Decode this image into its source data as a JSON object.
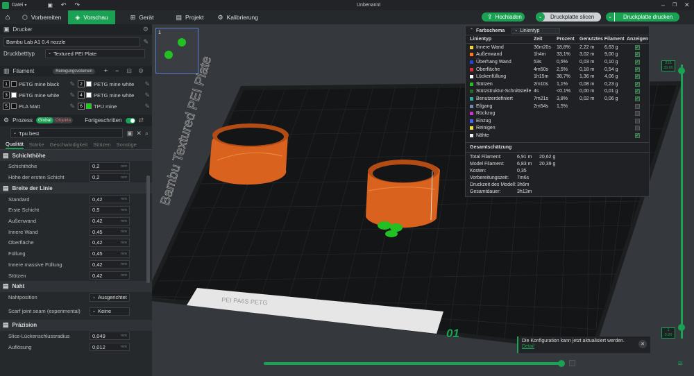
{
  "titlebar": {
    "menu_label": "Datei",
    "doc_title": "Unbenannt"
  },
  "tabs": [
    {
      "label": "Vorbereiten"
    },
    {
      "label": "Vorschau"
    },
    {
      "label": "Gerät"
    },
    {
      "label": "Projekt"
    },
    {
      "label": "Kalibrierung"
    }
  ],
  "actions": {
    "upload": "Hochladen",
    "slice": "Druckplatte slicen",
    "print": "Druckplatte drucken"
  },
  "printer": {
    "section": "Drucker",
    "name": "Bambu Lab A1 0.4 nozzle",
    "bed_label": "Druckbetttyp",
    "bed_value": "Textured PEI Plate"
  },
  "filament": {
    "section": "Filament",
    "purge_label": "Reinigungsvolumen",
    "slots": [
      {
        "num": "1",
        "name": "PETG mine black",
        "color": "#111111"
      },
      {
        "num": "2",
        "name": "PETG mine white",
        "color": "#ffffff"
      },
      {
        "num": "3",
        "name": "PETG mine white",
        "color": "#ffffff"
      },
      {
        "num": "4",
        "name": "PETG mine white",
        "color": "#ffffff"
      },
      {
        "num": "5",
        "name": "PLA Matt",
        "color": "#111111"
      },
      {
        "num": "6",
        "name": "TPU mine",
        "color": "#00e000"
      }
    ]
  },
  "process": {
    "section": "Prozess",
    "global": "Global",
    "objects": "Objekte",
    "advanced": "Fortgeschritten",
    "preset": "Tpu best",
    "subtabs": [
      "Qualität",
      "Stärke",
      "Geschwindigkeit",
      "Stützen",
      "Sonstige"
    ],
    "unit": "mm"
  },
  "params": {
    "layer_height": {
      "title": "Schichthöhe",
      "rows": [
        {
          "label": "Schichthöhe",
          "value": "0,2"
        },
        {
          "label": "Höhe der ersten Schicht",
          "value": "0,2"
        }
      ]
    },
    "line_width": {
      "title": "Breite der Linie",
      "rows": [
        {
          "label": "Standard",
          "value": "0,42"
        },
        {
          "label": "Erste Schicht",
          "value": "0,5"
        },
        {
          "label": "Außenwand",
          "value": "0,42"
        },
        {
          "label": "Innere Wand",
          "value": "0,45"
        },
        {
          "label": "Oberfläche",
          "value": "0,42"
        },
        {
          "label": "Füllung",
          "value": "0,45"
        },
        {
          "label": "Innere massive Füllung",
          "value": "0,42"
        },
        {
          "label": "Stützen",
          "value": "0,42"
        }
      ]
    },
    "seam": {
      "title": "Naht",
      "pos_label": "Nahtposition",
      "pos_value": "Ausgerichtet",
      "scarf_label": "Scarf joint seam (experimental)",
      "scarf_value": "Keine"
    },
    "precision": {
      "title": "Präzision",
      "rows": [
        {
          "label": "Slice-Lückenschlussradius",
          "value": "0,049"
        },
        {
          "label": "Auflösung",
          "value": "0,012"
        }
      ]
    }
  },
  "plate": {
    "label": "Bambu Textured PEI Plate",
    "plate_num": "01",
    "thumb_num": "1",
    "bottom_text": "PEI PA6S PETG"
  },
  "stats": {
    "scheme_label": "Farbschema",
    "scheme_value": "Linientyp",
    "headers": [
      "Linientyp",
      "Zeit",
      "Prozent",
      "Genutztes Filament",
      "Anzeigen"
    ],
    "lines": [
      {
        "name": "Innere Wand",
        "color": "#f5d742",
        "time": "36m20s",
        "pct": "18,8%",
        "len": "2,22 m",
        "g": "6,63 g",
        "show": true
      },
      {
        "name": "Außenwand",
        "color": "#ff7a1a",
        "time": "1h4m",
        "pct": "33,1%",
        "len": "3,02 m",
        "g": "9,00 g",
        "show": true
      },
      {
        "name": "Überhang Wand",
        "color": "#2244dd",
        "time": "53s",
        "pct": "0,5%",
        "len": "0,03 m",
        "g": "0,10 g",
        "show": true
      },
      {
        "name": "Oberfläche",
        "color": "#e03030",
        "time": "4m50s",
        "pct": "2,5%",
        "len": "0,18 m",
        "g": "0,54 g",
        "show": true
      },
      {
        "name": "Lückenfüllung",
        "color": "#ffffff",
        "time": "1h15m",
        "pct": "38,7%",
        "len": "1,36 m",
        "g": "4,06 g",
        "show": true
      },
      {
        "name": "Stützen",
        "color": "#22c022",
        "time": "2m10s",
        "pct": "1,1%",
        "len": "0,08 m",
        "g": "0,23 g",
        "show": true
      },
      {
        "name": "Stützstruktur-Schnittstelle",
        "color": "#1a6b1a",
        "time": "4s",
        "pct": "<0.1%",
        "len": "0,00 m",
        "g": "0,01 g",
        "show": true
      },
      {
        "name": "Benutzerdefiniert",
        "color": "#2ab0a0",
        "time": "7m21s",
        "pct": "3,8%",
        "len": "0,02 m",
        "g": "0,06 g",
        "show": true
      },
      {
        "name": "Eilgang",
        "color": "#7788aa",
        "time": "2m54s",
        "pct": "1,5%",
        "len": "",
        "g": "",
        "show": false
      },
      {
        "name": "Rückzug",
        "color": "#cc33cc",
        "time": "",
        "pct": "",
        "len": "",
        "g": "",
        "show": false
      },
      {
        "name": "Einzug",
        "color": "#4466ff",
        "time": "",
        "pct": "",
        "len": "",
        "g": "",
        "show": false
      },
      {
        "name": "Reinigen",
        "color": "#f0e040",
        "time": "",
        "pct": "",
        "len": "",
        "g": "",
        "show": false
      },
      {
        "name": "Nähte",
        "color": "#eeeeee",
        "time": "",
        "pct": "",
        "len": "",
        "g": "",
        "show": true
      }
    ],
    "summary_title": "Gesamtschätzung",
    "summary": [
      {
        "label": "Total Filament:",
        "a": "6,91 m",
        "b": "20,62 g"
      },
      {
        "label": "Model Filament:",
        "a": "6,83 m",
        "b": "20,39 g"
      },
      {
        "label": "Kosten:",
        "a": "0,35",
        "b": ""
      },
      {
        "label": "Vorbereitungszeit:",
        "a": "7m6s",
        "b": ""
      },
      {
        "label": "Druckzeit des Modell:",
        "a": "3h6m",
        "b": ""
      },
      {
        "label": "Gesamtdauer:",
        "a": "3h13m",
        "b": ""
      }
    ]
  },
  "layers": {
    "top_value": "215",
    "top_height": "39.65",
    "bottom_value": "1",
    "bottom_height": "0.20"
  },
  "notification": {
    "text": "Die Konfiguration kann jetzt aktualisiert werden.",
    "link": "Detail"
  },
  "colors": {
    "accent": "#1ba154",
    "model": "#d9621f",
    "support": "#22c022"
  }
}
